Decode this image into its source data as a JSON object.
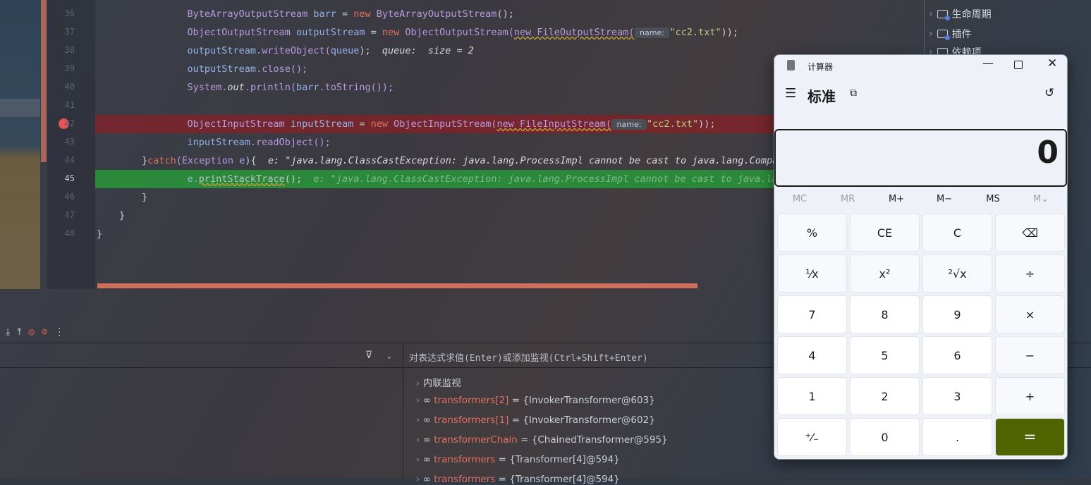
{
  "editor": {
    "line_numbers": [
      "36",
      "37",
      "38",
      "39",
      "40",
      "41",
      "42",
      "43",
      "44",
      "45",
      "46",
      "47",
      "48"
    ],
    "current_line": "45",
    "lines": [
      [
        [
          "    ",
          "p"
        ],
        [
          "ByteArrayOutputStream ",
          "ty"
        ],
        [
          "barr ",
          "v"
        ],
        [
          "= ",
          "p"
        ],
        [
          "new ",
          "k"
        ],
        [
          "ByteArrayOutputStream",
          "ty"
        ],
        [
          "();",
          "p"
        ]
      ],
      [
        [
          "    ",
          "p"
        ],
        [
          "ObjectOutputStream ",
          "ty"
        ],
        [
          "outputStream ",
          "v"
        ],
        [
          "= ",
          "p"
        ],
        [
          "new ",
          "k"
        ],
        [
          "ObjectOutputStream(",
          "ty"
        ],
        [
          "new FileOutputStream(",
          "sqk"
        ],
        [
          " name: ",
          "pm"
        ],
        [
          "\"cc2.txt\"",
          "s"
        ],
        [
          "));",
          "p"
        ]
      ],
      [
        [
          "    ",
          "p"
        ],
        [
          "outputStream",
          "v"
        ],
        [
          ".writeObject(",
          "m"
        ],
        [
          "queue",
          "v"
        ],
        [
          ");  ",
          "p"
        ],
        [
          "queue:  size = 2",
          "i"
        ]
      ],
      [
        [
          "    ",
          "p"
        ],
        [
          "outputStream",
          "v"
        ],
        [
          ".close();",
          "m"
        ]
      ],
      [
        [
          "    ",
          "p"
        ],
        [
          "System.",
          "ty"
        ],
        [
          "out",
          "i"
        ],
        [
          ".println(",
          "m"
        ],
        [
          "barr",
          "v"
        ],
        [
          ".toString());",
          "m"
        ]
      ],
      [],
      [
        [
          "    ",
          "p"
        ],
        [
          "ObjectInputStream ",
          "ty"
        ],
        [
          "inputStream ",
          "v"
        ],
        [
          "= ",
          "p"
        ],
        [
          "new ",
          "k"
        ],
        [
          "ObjectInputStream(",
          "ty"
        ],
        [
          "new FileInputStream(",
          "sqk"
        ],
        [
          " name: ",
          "pm"
        ],
        [
          "\"cc2.txt\"",
          "s"
        ],
        [
          "));",
          "p"
        ]
      ],
      [
        [
          "    ",
          "p"
        ],
        [
          "inputStream",
          "v"
        ],
        [
          ".readObject();",
          "m"
        ]
      ],
      [
        [
          "}",
          "p"
        ],
        [
          "catch",
          "k"
        ],
        [
          "(Exception ",
          "ty"
        ],
        [
          "e",
          "v"
        ],
        [
          "){  ",
          "p"
        ],
        [
          "e: \"java.lang.ClassCastException: java.lang.ProcessImpl cannot be cast to java.lang.Comparable\"",
          "i"
        ]
      ],
      [
        [
          "    ",
          "p"
        ],
        [
          "e.",
          "v"
        ],
        [
          "printStackTrace",
          "sq"
        ],
        [
          "();  ",
          "p"
        ],
        [
          "e: \"java.lang.ClassCastException: java.lang.ProcessImpl cannot be cast to java.lang.Comparable\"",
          "ig"
        ]
      ],
      [
        [
          "}",
          "p"
        ]
      ],
      [
        [
          "}",
          "p"
        ]
      ],
      [
        [
          "}",
          "p"
        ]
      ]
    ]
  },
  "project_tree": {
    "items": [
      {
        "label": "生命周期"
      },
      {
        "label": "插件"
      },
      {
        "label": "依赖项"
      }
    ]
  },
  "debugger": {
    "eval_placeholder": "对表达式求值(Enter)或添加监视(Ctrl+Shift+Enter)",
    "watches": [
      {
        "name": "内联监视",
        "value": ""
      },
      {
        "name": "transformers[2]",
        "value": " = {InvokerTransformer@603}"
      },
      {
        "name": "transformers[1]",
        "value": " = {InvokerTransformer@602}"
      },
      {
        "name": "transformerChain",
        "value": " = {ChainedTransformer@595}"
      },
      {
        "name": "transformers",
        "value": " = {Transformer[4]@594}"
      },
      {
        "name": "transformers",
        "value": " = {Transformer[4]@594}"
      }
    ]
  },
  "calculator": {
    "title": "计算器",
    "mode": "标准",
    "display": "0",
    "memory": [
      "MC",
      "MR",
      "M+",
      "M−",
      "MS",
      "M⌄"
    ],
    "buttons": [
      [
        "%",
        "CE",
        "C",
        "⌫"
      ],
      [
        "¹⁄x",
        "x²",
        "²√x",
        "÷"
      ],
      [
        "7",
        "8",
        "9",
        "×"
      ],
      [
        "4",
        "5",
        "6",
        "−"
      ],
      [
        "1",
        "2",
        "3",
        "+"
      ],
      [
        "⁺⁄₋",
        "0",
        ".",
        "="
      ]
    ],
    "accent": "#4f6400"
  }
}
